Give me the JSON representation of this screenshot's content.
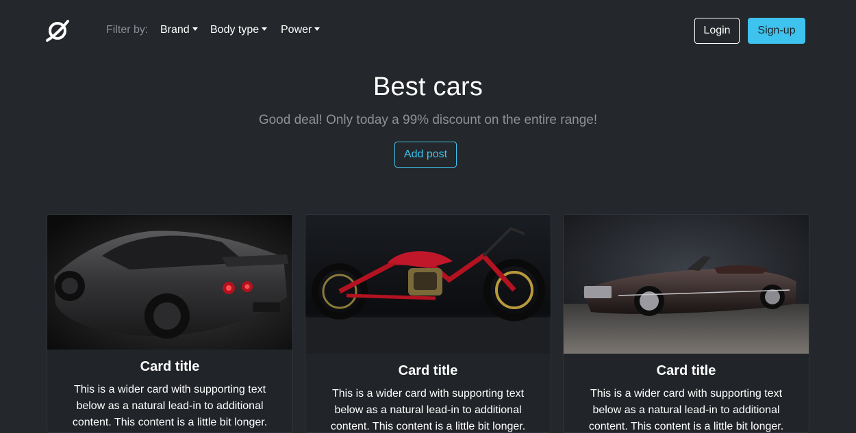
{
  "navbar": {
    "logo_icon": "planet-ring-icon",
    "filter_label": "Filter by:",
    "filters": {
      "brand": "Brand",
      "body_type": "Body type",
      "power": "Power"
    },
    "login_label": "Login",
    "signup_label": "Sign-up"
  },
  "hero": {
    "title": "Best cars",
    "subtitle": "Good deal! Only today a 99% discount on the entire range!",
    "add_post_label": "Add post"
  },
  "cards": [
    {
      "title": "Card title",
      "text": "This is a wider card with supporting text below as a natural lead-in to additional content. This content is a little bit longer."
    },
    {
      "title": "Card title",
      "text": "This is a wider card with supporting text below as a natural lead-in to additional content. This content is a little bit longer."
    },
    {
      "title": "Card title",
      "text": "This is a wider card with supporting text below as a natural lead-in to additional content. This content is a little bit longer."
    }
  ],
  "colors": {
    "background": "#24272b",
    "accent": "#3ec3ee",
    "muted_text": "#8e9296"
  }
}
